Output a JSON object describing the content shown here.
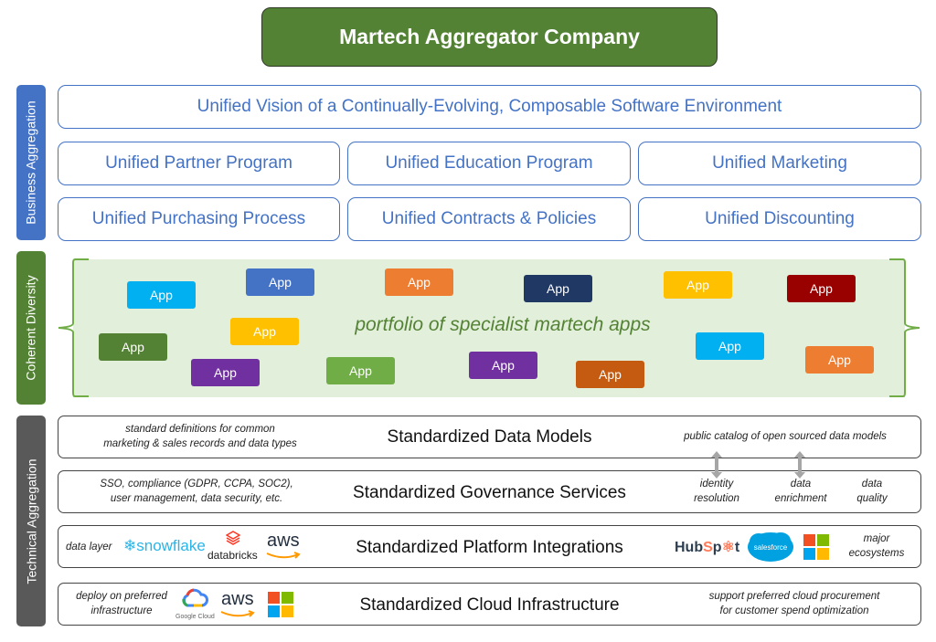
{
  "title": "Martech Aggregator Company",
  "side_tabs": {
    "business": "Business Aggregation",
    "coherent": "Coherent Diversity",
    "technical": "Technical Aggregation"
  },
  "business": {
    "vision": "Unified Vision of a Continually-Evolving, Composable Software Environment",
    "row1": [
      "Unified Partner Program",
      "Unified Education Program",
      "Unified Marketing"
    ],
    "row2": [
      "Unified Purchasing Process",
      "Unified Contracts & Policies",
      "Unified Discounting"
    ]
  },
  "diversity": {
    "caption": "portfolio of specialist martech apps",
    "app_label": "App",
    "apps": [
      {
        "label": "App",
        "color": "#00b0f0"
      },
      {
        "label": "App",
        "color": "#4472c4"
      },
      {
        "label": "App",
        "color": "#ed7d31"
      },
      {
        "label": "App",
        "color": "#203864"
      },
      {
        "label": "App",
        "color": "#ffc000"
      },
      {
        "label": "App",
        "color": "#990000"
      },
      {
        "label": "App",
        "color": "#ffc000"
      },
      {
        "label": "App",
        "color": "#548235"
      },
      {
        "label": "App",
        "color": "#7030a0"
      },
      {
        "label": "App",
        "color": "#70ad47"
      },
      {
        "label": "App",
        "color": "#7030a0"
      },
      {
        "label": "App",
        "color": "#c55a11"
      },
      {
        "label": "App",
        "color": "#00b0f0"
      },
      {
        "label": "App",
        "color": "#ed7d31"
      }
    ]
  },
  "technical": {
    "data_models": {
      "title": "Standardized Data Models",
      "left_note": [
        "standard definitions for common",
        "marketing & sales records and data types"
      ],
      "right_note": "public catalog of open sourced data models"
    },
    "governance": {
      "title": "Standardized Governance Services",
      "left_note": [
        "SSO, compliance (GDPR, CCPA, SOC2),",
        "user management, data security, etc."
      ],
      "services": [
        [
          "identity",
          "resolution"
        ],
        [
          "data",
          "enrichment"
        ],
        [
          "data",
          "quality"
        ]
      ]
    },
    "platform": {
      "title": "Standardized Platform Integrations",
      "left_label": "data layer",
      "data_layer_logos": [
        "snowflake",
        "databricks",
        "aws"
      ],
      "ecosystem_logos": [
        "HubSpot",
        "salesforce",
        "Microsoft"
      ],
      "right_note": [
        "major",
        "ecosystems"
      ]
    },
    "cloud": {
      "title": "Standardized Cloud Infrastructure",
      "left_note": [
        "deploy on preferred",
        "infrastructure"
      ],
      "cloud_logos": [
        "Google Cloud",
        "aws",
        "Microsoft"
      ],
      "right_note": [
        "support preferred cloud procurement",
        "for customer spend optimization"
      ]
    }
  },
  "colors": {
    "business_blue": "#4472c4",
    "coherent_green": "#548235",
    "technical_gray": "#595959",
    "diversity_bg": "#e2efda"
  }
}
